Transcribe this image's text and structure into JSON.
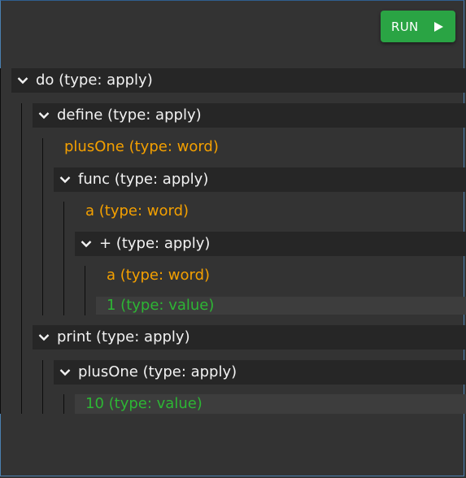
{
  "toolbar": {
    "run_label": "RUN"
  },
  "tree": {
    "do": "do (type: apply)",
    "define": "define (type: apply)",
    "plusOne_word": "plusOne (type: word)",
    "func": "func (type: apply)",
    "a_word_1": "a (type: word)",
    "plus": "+ (type: apply)",
    "a_word_2": "a (type: word)",
    "one_value": "1 (type: value)",
    "print": "print (type: apply)",
    "plusOne_apply": "plusOne (type: apply)",
    "ten_value": "10 (type: value)"
  },
  "colors": {
    "background": "#333333",
    "apply": "#f2f2f2",
    "word": "#f4a000",
    "value": "#2db634",
    "run_button": "#2aa444"
  },
  "icons": {
    "run": "play-icon",
    "expand": "chevron-down-icon"
  }
}
